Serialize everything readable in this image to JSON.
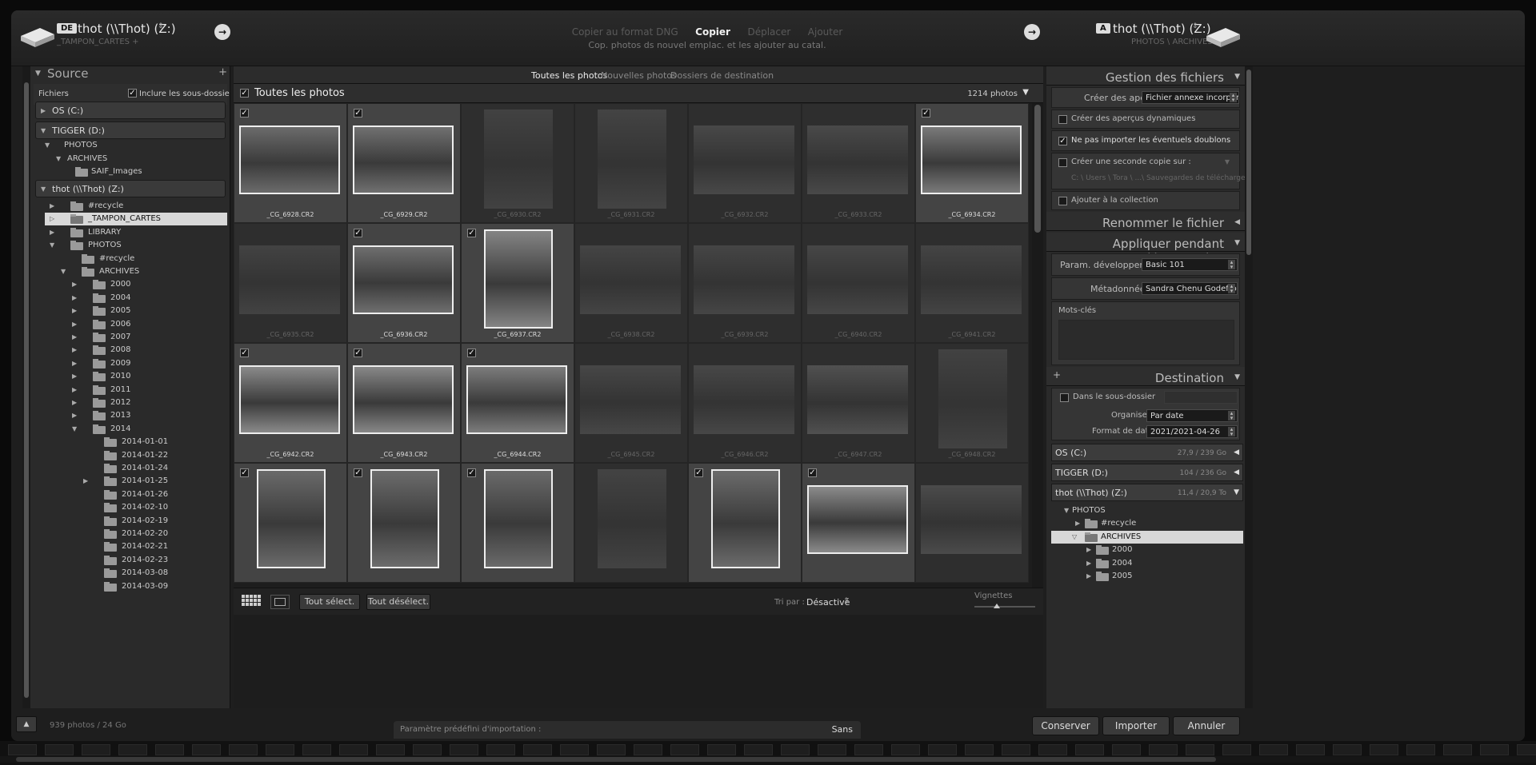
{
  "header": {
    "source_badge": "DE",
    "source_title": "thot (\\\\Thot) (Z:)",
    "source_path": "_TAMPON_CARTES +",
    "dest_badge": "A",
    "dest_title": "thot (\\\\Thot) (Z:)",
    "dest_path": "PHOTOS \\ ARCHIVES",
    "modes": [
      "Copier au format DNG",
      "Copier",
      "Déplacer",
      "Ajouter"
    ],
    "active_mode": "Copier",
    "mode_desc": "Cop. photos ds nouvel emplac. et les ajouter au catal."
  },
  "source": {
    "title": "Source",
    "files_label": "Fichiers",
    "include_sub": "Inclure les sous-dossiers",
    "volumes": [
      "OS (C:)",
      "TIGGER (D:)",
      "thot (\\\\Thot) (Z:)"
    ],
    "d_items": [
      "PHOTOS",
      "ARCHIVES",
      "SAIF_Images"
    ],
    "z_items": [
      "#recycle",
      "_TAMPON_CARTES",
      "LIBRARY",
      "PHOTOS",
      "#recycle",
      "ARCHIVES",
      "2000",
      "2004",
      "2005",
      "2006",
      "2007",
      "2008",
      "2009",
      "2010",
      "2011",
      "2012",
      "2013",
      "2014",
      "2014-01-01",
      "2014-01-22",
      "2014-01-24",
      "2014-01-25",
      "2014-01-26",
      "2014-02-10",
      "2014-02-19",
      "2014-02-20",
      "2014-02-21",
      "2014-02-23",
      "2014-03-08",
      "2014-03-09"
    ],
    "status": "939 photos / 24 Go"
  },
  "center": {
    "tabs": [
      "Toutes les photos",
      "Nouvelles photos",
      "Dossiers de destination"
    ],
    "header_title": "Toutes les photos",
    "count": "1214 photos",
    "photos": [
      {
        "name": "_CG_6928.CR2",
        "checked": true
      },
      {
        "name": "_CG_6929.CR2",
        "checked": true
      },
      {
        "name": "_CG_6930.CR2",
        "checked": false
      },
      {
        "name": "_CG_6931.CR2",
        "checked": false
      },
      {
        "name": "_CG_6932.CR2",
        "checked": false
      },
      {
        "name": "_CG_6933.CR2",
        "checked": false
      },
      {
        "name": "_CG_6934.CR2",
        "checked": true
      },
      {
        "name": "_CG_6935.CR2",
        "checked": false
      },
      {
        "name": "_CG_6936.CR2",
        "checked": true
      },
      {
        "name": "_CG_6937.CR2",
        "checked": true
      },
      {
        "name": "_CG_6938.CR2",
        "checked": false
      },
      {
        "name": "_CG_6939.CR2",
        "checked": false
      },
      {
        "name": "_CG_6940.CR2",
        "checked": false
      },
      {
        "name": "_CG_6941.CR2",
        "checked": false
      },
      {
        "name": "_CG_6942.CR2",
        "checked": true
      },
      {
        "name": "_CG_6943.CR2",
        "checked": true
      },
      {
        "name": "_CG_6944.CR2",
        "checked": true
      },
      {
        "name": "_CG_6945.CR2",
        "checked": false
      },
      {
        "name": "_CG_6946.CR2",
        "checked": false
      },
      {
        "name": "_CG_6947.CR2",
        "checked": false
      },
      {
        "name": "_CG_6948.CR2",
        "checked": false
      },
      {
        "name": "",
        "checked": true
      },
      {
        "name": "",
        "checked": true
      },
      {
        "name": "",
        "checked": true
      },
      {
        "name": "",
        "checked": false
      },
      {
        "name": "",
        "checked": true
      },
      {
        "name": "",
        "checked": true
      },
      {
        "name": "",
        "checked": false
      }
    ],
    "select_all": "Tout sélect.",
    "deselect_all": "Tout désélect.",
    "sort_label": "Tri par :",
    "sort_value": "Désactivé",
    "thumb_label": "Vignettes"
  },
  "right": {
    "file_handling": "Gestion des fichiers",
    "previews_label": "Créer des aperçus",
    "previews_value": "Fichier annexe incorporé",
    "smart_previews": "Créer des aperçus dynamiques",
    "no_duplicates": "Ne pas importer les éventuels doublons",
    "second_copy": "Créer une seconde copie sur :",
    "second_copy_path": "C: \\ Users \\ Tora \\ ...\\ Sauvegardes de téléchargement",
    "add_collection": "Ajouter à la collection",
    "rename": "Renommer le fichier",
    "apply": "Appliquer pendant l'importation",
    "dev_label": "Param. développement",
    "dev_value": "Basic 101",
    "meta_label": "Métadonnées",
    "meta_value": "Sandra Chenu Godefroy",
    "keywords": "Mots-clés",
    "destination": "Destination",
    "subfolder": "Dans le sous-dossier",
    "organize_label": "Organiser",
    "organize_value": "Par date",
    "date_label": "Format de date",
    "date_value": "2021/2021-04-26",
    "volumes": [
      {
        "name": "OS (C:)",
        "cap": "27,9 / 239 Go"
      },
      {
        "name": "TIGGER (D:)",
        "cap": "104 / 236 Go"
      },
      {
        "name": "thot (\\\\Thot) (Z:)",
        "cap": "11,4 / 20,9 To"
      }
    ],
    "tree": [
      "PHOTOS",
      "#recycle",
      "ARCHIVES",
      "2000",
      "2004",
      "2005"
    ]
  },
  "footer": {
    "preset_label": "Paramètre prédéfini d'importation :",
    "preset_value": "Sans",
    "keep": "Conserver",
    "import": "Importer",
    "cancel": "Annuler"
  }
}
